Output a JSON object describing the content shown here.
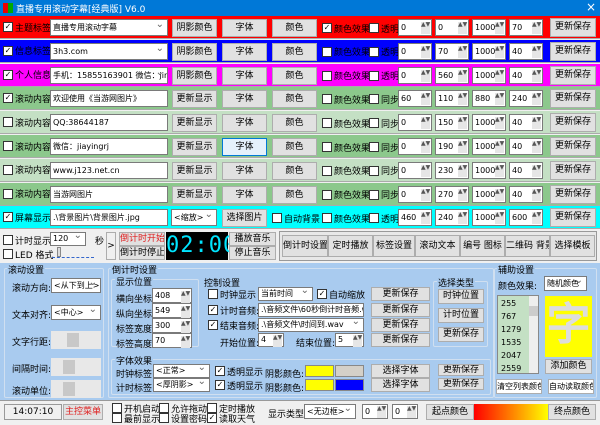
{
  "title": "直播专用滚动字幕[经典版] V6.0",
  "close_icon": "×",
  "rows": [
    {
      "label": "主题标签",
      "checked": true,
      "value": "直播专用滚动字幕",
      "combo": true,
      "b1": "阴影颜色",
      "b2": "字体",
      "b3": "颜色",
      "c1": "颜色效果",
      "c1v": true,
      "c2": "透明",
      "nums": [
        "0",
        "0",
        "1000",
        "70"
      ],
      "save": "更新保存",
      "bg": "#ff0000"
    },
    {
      "label": "信息标签",
      "checked": true,
      "value": "3h3.com",
      "combo": true,
      "b1": "阴影颜色",
      "b2": "字体",
      "b3": "颜色",
      "c1": "颜色效果",
      "c1v": false,
      "c2": "透明",
      "nums": [
        "0",
        "70",
        "1000",
        "40"
      ],
      "save": "更新保存",
      "bg": "#0000ff"
    },
    {
      "label": "个人信息",
      "checked": true,
      "value": "手机：15855163901    微信：jin",
      "combo": true,
      "b1": "阴影颜色",
      "b2": "字体",
      "b3": "颜色",
      "c1": "颜色效果",
      "c1v": false,
      "c2": "透明",
      "nums": [
        "0",
        "560",
        "1000",
        "40"
      ],
      "save": "更新保存",
      "bg": "#ff00ff"
    },
    {
      "label": "滚动内容 1",
      "checked": true,
      "value": "欢迎使用《当游网图片》",
      "combo": false,
      "b1": "更新显示",
      "b2": "字体",
      "b3": "颜色",
      "c1": "颜色效果",
      "c1v": false,
      "c2": "同步",
      "nums": [
        "60",
        "110",
        "880",
        "240"
      ],
      "save": "更新保存",
      "bg": "#8cc88c"
    },
    {
      "label": "滚动内容 2",
      "checked": false,
      "value": "QQ:38644187",
      "combo": false,
      "b1": "更新显示",
      "b2": "字体",
      "b3": "颜色",
      "c1": "颜色效果",
      "c1v": false,
      "c2": "同步",
      "nums": [
        "0",
        "150",
        "1000",
        "40"
      ],
      "save": "更新保存",
      "bg": "#c4e0c4"
    },
    {
      "label": "滚动内容 3",
      "checked": false,
      "value": "微信：jiayingrj",
      "combo": false,
      "b1": "更新显示",
      "b2": "字体",
      "b3": "颜色",
      "c1": "颜色效果",
      "c1v": false,
      "c2": "同步",
      "nums": [
        "0",
        "190",
        "1000",
        "40"
      ],
      "save": "更新保存",
      "bg": "#8cc88c"
    },
    {
      "label": "滚动内容 4",
      "checked": false,
      "value": "www.j123.net.cn",
      "combo": false,
      "b1": "更新显示",
      "b2": "字体",
      "b3": "颜色",
      "c1": "颜色效果",
      "c1v": false,
      "c2": "同步",
      "nums": [
        "0",
        "230",
        "1000",
        "40"
      ],
      "save": "更新保存",
      "bg": "#c4e0c4"
    },
    {
      "label": "滚动内容 5",
      "checked": false,
      "value": "当游网图片",
      "combo": false,
      "b1": "更新显示",
      "b2": "字体",
      "b3": "颜色",
      "c1": "颜色效果",
      "c1v": false,
      "c2": "同步",
      "nums": [
        "0",
        "270",
        "1000",
        "40"
      ],
      "save": "更新保存",
      "bg": "#8cc88c"
    },
    {
      "label": "屏幕显示",
      "checked": true,
      "value": ".\\背景图片\\背景图片.jpg",
      "combo": false,
      "select": "<缩放>",
      "b2": "选择图片",
      "c0": "自动背景",
      "c1": "颜色效果",
      "c1v": false,
      "c2": "透明",
      "nums": [
        "460",
        "240",
        "1000",
        "600"
      ],
      "save": "更新保存",
      "bg": "#00ffff"
    }
  ],
  "timer": {
    "show": "计时显示",
    "led": "LED 格式",
    "seconds": "120",
    "sec_unit": "秒",
    "arrow": ">",
    "start": "倒计时开始",
    "stop": "倒计时停止",
    "display": "02:00",
    "play": "播放音乐",
    "stop_music": "停止音乐"
  },
  "tabs": [
    "倒计时设置",
    "定时播放",
    "标签设置",
    "滚动文本",
    "编号 图标",
    "二维码 背景",
    "选择模板"
  ],
  "scroll": {
    "title": "滚动设置",
    "direction_label": "滚动方向:",
    "direction": "<从下到上>",
    "align_label": "文本对齐:",
    "align": "<中心>",
    "spacing_label": "文字行距:",
    "interval_label": "间隔时间:",
    "unit_label": "滚动单位:"
  },
  "countdown": {
    "title": "倒计时设置",
    "pos_title": "显示位置",
    "x_label": "横向坐标:",
    "x": "408",
    "y_label": "纵向坐标:",
    "y": "549",
    "w_label": "标签宽度:",
    "w": "300",
    "h_label": "标签高度:",
    "h": "70",
    "font_title": "字体效果",
    "clock_label": "时钟标签:",
    "clock": "<正常>",
    "timer_label": "计时标签:",
    "timer": "<厚阴影>",
    "transparent": "透明显示",
    "shadow_label": "阴影颜色:",
    "choose_font": "选择字体"
  },
  "control": {
    "title": "控制设置",
    "clock_show": "时钟显示",
    "clock_mode": "当前时间",
    "auto_zoom": "自动缩放",
    "timer_audio": "计时音频:",
    "timer_audio_file": ".\\音频文件\\60秒倒计时音频.w",
    "end_audio": "结束音频:",
    "end_audio_file": ".\\音频文件\\时间到.wav",
    "start_pos": "开始位置:",
    "start": "4",
    "end_pos": "结束位置:",
    "end": "5",
    "save": "更新保存"
  },
  "type": {
    "title": "选择类型",
    "clock_pos": "时钟位置",
    "timer_pos": "计时位置",
    "save": "更新保存"
  },
  "aux": {
    "title": "辅助设置",
    "effect_label": "颜色效果:",
    "effect": "随机颜色",
    "list": [
      "255",
      "767",
      "1279",
      "1535",
      "2047",
      "2559"
    ],
    "preview": "字",
    "add": "添加颜色",
    "clear": "清空列表颜色",
    "auto": "自动读取颜色"
  },
  "status": {
    "time": "14:07:10",
    "menu": "主控菜单",
    "boot": "开机启动",
    "drag": "允许拖动",
    "timed": "定时播放",
    "top": "最前显示",
    "pwd": "设置密码",
    "weather": "读取天气",
    "type_label": "显示类型:",
    "type": "<无边框>",
    "n1": "0",
    "n2": "0",
    "start_color": "起点颜色",
    "end_color": "终点颜色"
  },
  "colors": {
    "titlebar": "#0078d7",
    "panel": "#a9cbef",
    "led": "#00e5ff",
    "accent_red": "#e02020"
  }
}
